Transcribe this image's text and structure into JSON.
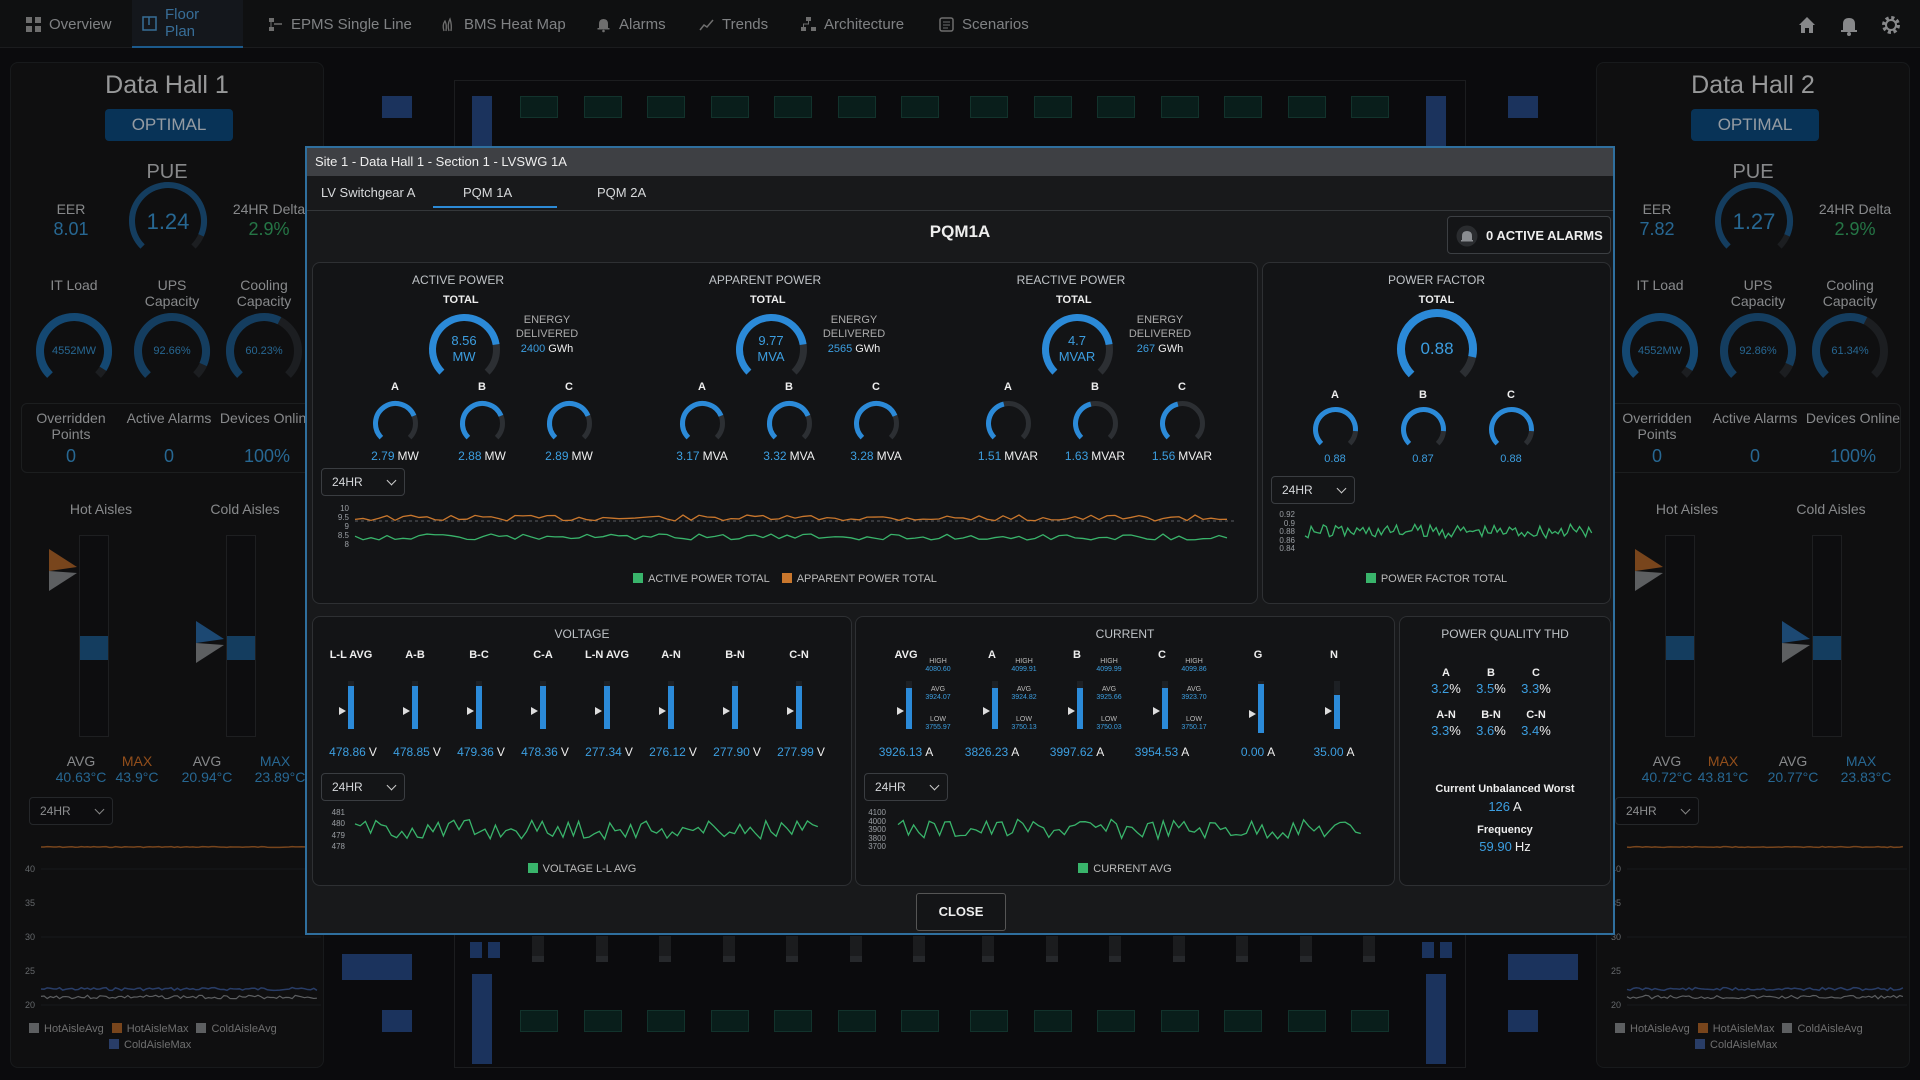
{
  "nav": {
    "tabs": [
      {
        "label": "Overview",
        "icon": "grid-icon"
      },
      {
        "label": "Floor Plan",
        "icon": "floorplan-icon"
      },
      {
        "label": "EPMS Single Line",
        "icon": "single-line-icon"
      },
      {
        "label": "BMS Heat Map",
        "icon": "heat-icon"
      },
      {
        "label": "Alarms",
        "icon": "bell-icon"
      },
      {
        "label": "Trends",
        "icon": "trend-icon"
      },
      {
        "label": "Architecture",
        "icon": "architecture-icon"
      },
      {
        "label": "Scenarios",
        "icon": "scenarios-icon"
      }
    ],
    "active_tab": "Floor Plan"
  },
  "hall1": {
    "title": "Data Hall 1",
    "status": "OPTIMAL",
    "pue_label": "PUE",
    "pue": "1.24",
    "eer_label": "EER",
    "eer": "8.01",
    "delta_label": "24HR Delta",
    "delta": "2.9%",
    "it_load_label": "IT Load",
    "it_load": "4552MW",
    "ups_label": "UPS Capacity",
    "ups": "92.66%",
    "cooling_label": "Cooling Capacity",
    "cooling": "60.23%",
    "overridden_label": "Overridden Points",
    "overridden": "0",
    "alarms_label": "Active Alarms",
    "alarms": "0",
    "devices_label": "Devices Online",
    "devices": "100%",
    "hot_label": "Hot Aisles",
    "cold_label": "Cold Aisles",
    "hot_avg_label": "AVG",
    "hot_avg": "40.63°C",
    "hot_max_label": "MAX",
    "hot_max": "43.9°C",
    "cold_avg_label": "AVG",
    "cold_avg": "20.94°C",
    "cold_max_label": "MAX",
    "cold_max": "23.89°C",
    "range": "24HR",
    "yticks": [
      "40",
      "35",
      "30",
      "25",
      "20"
    ],
    "legend": [
      "HotAisleAvg",
      "HotAisleMax",
      "ColdAisleAvg",
      "ColdAisleMax"
    ]
  },
  "hall2": {
    "title": "Data Hall 2",
    "status": "OPTIMAL",
    "pue_label": "PUE",
    "pue": "1.27",
    "eer_label": "EER",
    "eer": "7.82",
    "delta_label": "24HR Delta",
    "delta": "2.9%",
    "it_load_label": "IT Load",
    "it_load": "4552MW",
    "ups_label": "UPS Capacity",
    "ups": "92.86%",
    "cooling_label": "Cooling Capacity",
    "cooling": "61.34%",
    "overridden_label": "Overridden Points",
    "overridden": "0",
    "alarms_label": "Active Alarms",
    "alarms": "0",
    "devices_label": "Devices Online",
    "devices": "100%",
    "hot_label": "Hot Aisles",
    "cold_label": "Cold Aisles",
    "hot_avg_label": "AVG",
    "hot_avg": "40.72°C",
    "hot_max_label": "MAX",
    "hot_max": "43.81°C",
    "cold_avg_label": "AVG",
    "cold_avg": "20.77°C",
    "cold_max_label": "MAX",
    "cold_max": "23.83°C",
    "range": "24HR",
    "yticks": [
      "40",
      "35",
      "30",
      "25",
      "20"
    ],
    "legend": [
      "HotAisleAvg",
      "HotAisleMax",
      "ColdAisleAvg",
      "ColdAisleMax"
    ]
  },
  "modal": {
    "breadcrumb": "Site 1 - Data Hall 1 - Section 1 - LVSWG 1A",
    "tabs": [
      "LV Switchgear A",
      "PQM 1A",
      "PQM 2A"
    ],
    "title": "PQM1A",
    "alarms_button": "0 ACTIVE ALARMS",
    "close": "CLOSE",
    "active_power": {
      "title": "ACTIVE POWER",
      "total_label": "TOTAL",
      "total": "8.56",
      "unit": "MW",
      "energy_label": "ENERGY DELIVERED",
      "energy": "2400",
      "energy_unit": "GWh",
      "phases": [
        {
          "name": "A",
          "value": "2.79",
          "unit": "MW"
        },
        {
          "name": "B",
          "value": "2.88",
          "unit": "MW"
        },
        {
          "name": "C",
          "value": "2.89",
          "unit": "MW"
        }
      ]
    },
    "apparent_power": {
      "title": "APPARENT POWER",
      "total_label": "TOTAL",
      "total": "9.77",
      "unit": "MVA",
      "energy_label": "ENERGY DELIVERED",
      "energy": "2565",
      "energy_unit": "GWh",
      "phases": [
        {
          "name": "A",
          "value": "3.17",
          "unit": "MVA"
        },
        {
          "name": "B",
          "value": "3.32",
          "unit": "MVA"
        },
        {
          "name": "C",
          "value": "3.28",
          "unit": "MVA"
        }
      ]
    },
    "reactive_power": {
      "title": "REACTIVE POWER",
      "total_label": "TOTAL",
      "total": "4.7",
      "unit": "MVAR",
      "energy_label": "ENERGY DELIVERED",
      "energy": "267",
      "energy_unit": "GWh",
      "phases": [
        {
          "name": "A",
          "value": "1.51",
          "unit": "MVAR"
        },
        {
          "name": "B",
          "value": "1.63",
          "unit": "MVAR"
        },
        {
          "name": "C",
          "value": "1.56",
          "unit": "MVAR"
        }
      ]
    },
    "power_factor": {
      "title": "POWER FACTOR",
      "total_label": "TOTAL",
      "total": "0.88",
      "phases": [
        {
          "name": "A",
          "value": "0.88"
        },
        {
          "name": "B",
          "value": "0.87"
        },
        {
          "name": "C",
          "value": "0.88"
        }
      ],
      "range": "24HR",
      "yticks": [
        "0.92",
        "0.9",
        "0.88",
        "0.86",
        "0.84"
      ],
      "legend": "POWER FACTOR TOTAL"
    },
    "power_chart": {
      "range": "24HR",
      "yticks": [
        "10",
        "9.5",
        "9",
        "8.5",
        "8"
      ],
      "legend": [
        "ACTIVE POWER TOTAL",
        "APPARENT POWER TOTAL"
      ]
    },
    "voltage": {
      "title": "VOLTAGE",
      "unit": "V",
      "range": "24HR",
      "items": [
        {
          "name": "L-L AVG",
          "value": "478.86"
        },
        {
          "name": "A-B",
          "value": "478.85"
        },
        {
          "name": "B-C",
          "value": "479.36"
        },
        {
          "name": "C-A",
          "value": "478.36"
        },
        {
          "name": "L-N AVG",
          "value": "277.34"
        },
        {
          "name": "A-N",
          "value": "276.12"
        },
        {
          "name": "B-N",
          "value": "277.90"
        },
        {
          "name": "C-N",
          "value": "277.99"
        }
      ],
      "yticks": [
        "481",
        "480",
        "479",
        "478"
      ],
      "legend": "VOLTAGE L-L AVG"
    },
    "current": {
      "title": "CURRENT",
      "unit": "A",
      "range": "24HR",
      "items": [
        {
          "name": "AVG",
          "value": "3926.13",
          "high_label": "HIGH",
          "high": "4080.60",
          "avg_label": "AVG",
          "avg": "3924.07",
          "low_label": "LOW",
          "low": "3755.97"
        },
        {
          "name": "A",
          "value": "3826.23",
          "high_label": "HIGH",
          "high": "4099.91",
          "avg_label": "AVG",
          "avg": "3924.82",
          "low_label": "LOW",
          "low": "3750.13"
        },
        {
          "name": "B",
          "value": "3997.62",
          "high_label": "HIGH",
          "high": "4099.99",
          "avg_label": "AVG",
          "avg": "3925.66",
          "low_label": "LOW",
          "low": "3750.03"
        },
        {
          "name": "C",
          "value": "3954.53",
          "high_label": "HIGH",
          "high": "4099.86",
          "avg_label": "AVG",
          "avg": "3923.70",
          "low_label": "LOW",
          "low": "3750.17"
        },
        {
          "name": "G",
          "value": "0.00"
        },
        {
          "name": "N",
          "value": "35.00"
        }
      ],
      "yticks": [
        "4100",
        "4000",
        "3900",
        "3800",
        "3700"
      ],
      "legend": "CURRENT AVG"
    },
    "thd": {
      "title": "POWER QUALITY THD",
      "row1": [
        {
          "name": "A",
          "value": "3.2"
        },
        {
          "name": "B",
          "value": "3.5"
        },
        {
          "name": "C",
          "value": "3.3"
        }
      ],
      "row2": [
        {
          "name": "A-N",
          "value": "3.3"
        },
        {
          "name": "B-N",
          "value": "3.6"
        },
        {
          "name": "C-N",
          "value": "3.4"
        }
      ],
      "pct": "%",
      "unbal_label": "Current Unbalanced Worst",
      "unbal": "126",
      "unbal_unit": "A",
      "freq_label": "Frequency",
      "freq": "59.90",
      "freq_unit": "Hz"
    }
  },
  "colors": {
    "accent": "#2b8ad8",
    "green": "#39b46b",
    "orange": "#e2792a",
    "badge": "#0d4f86"
  }
}
